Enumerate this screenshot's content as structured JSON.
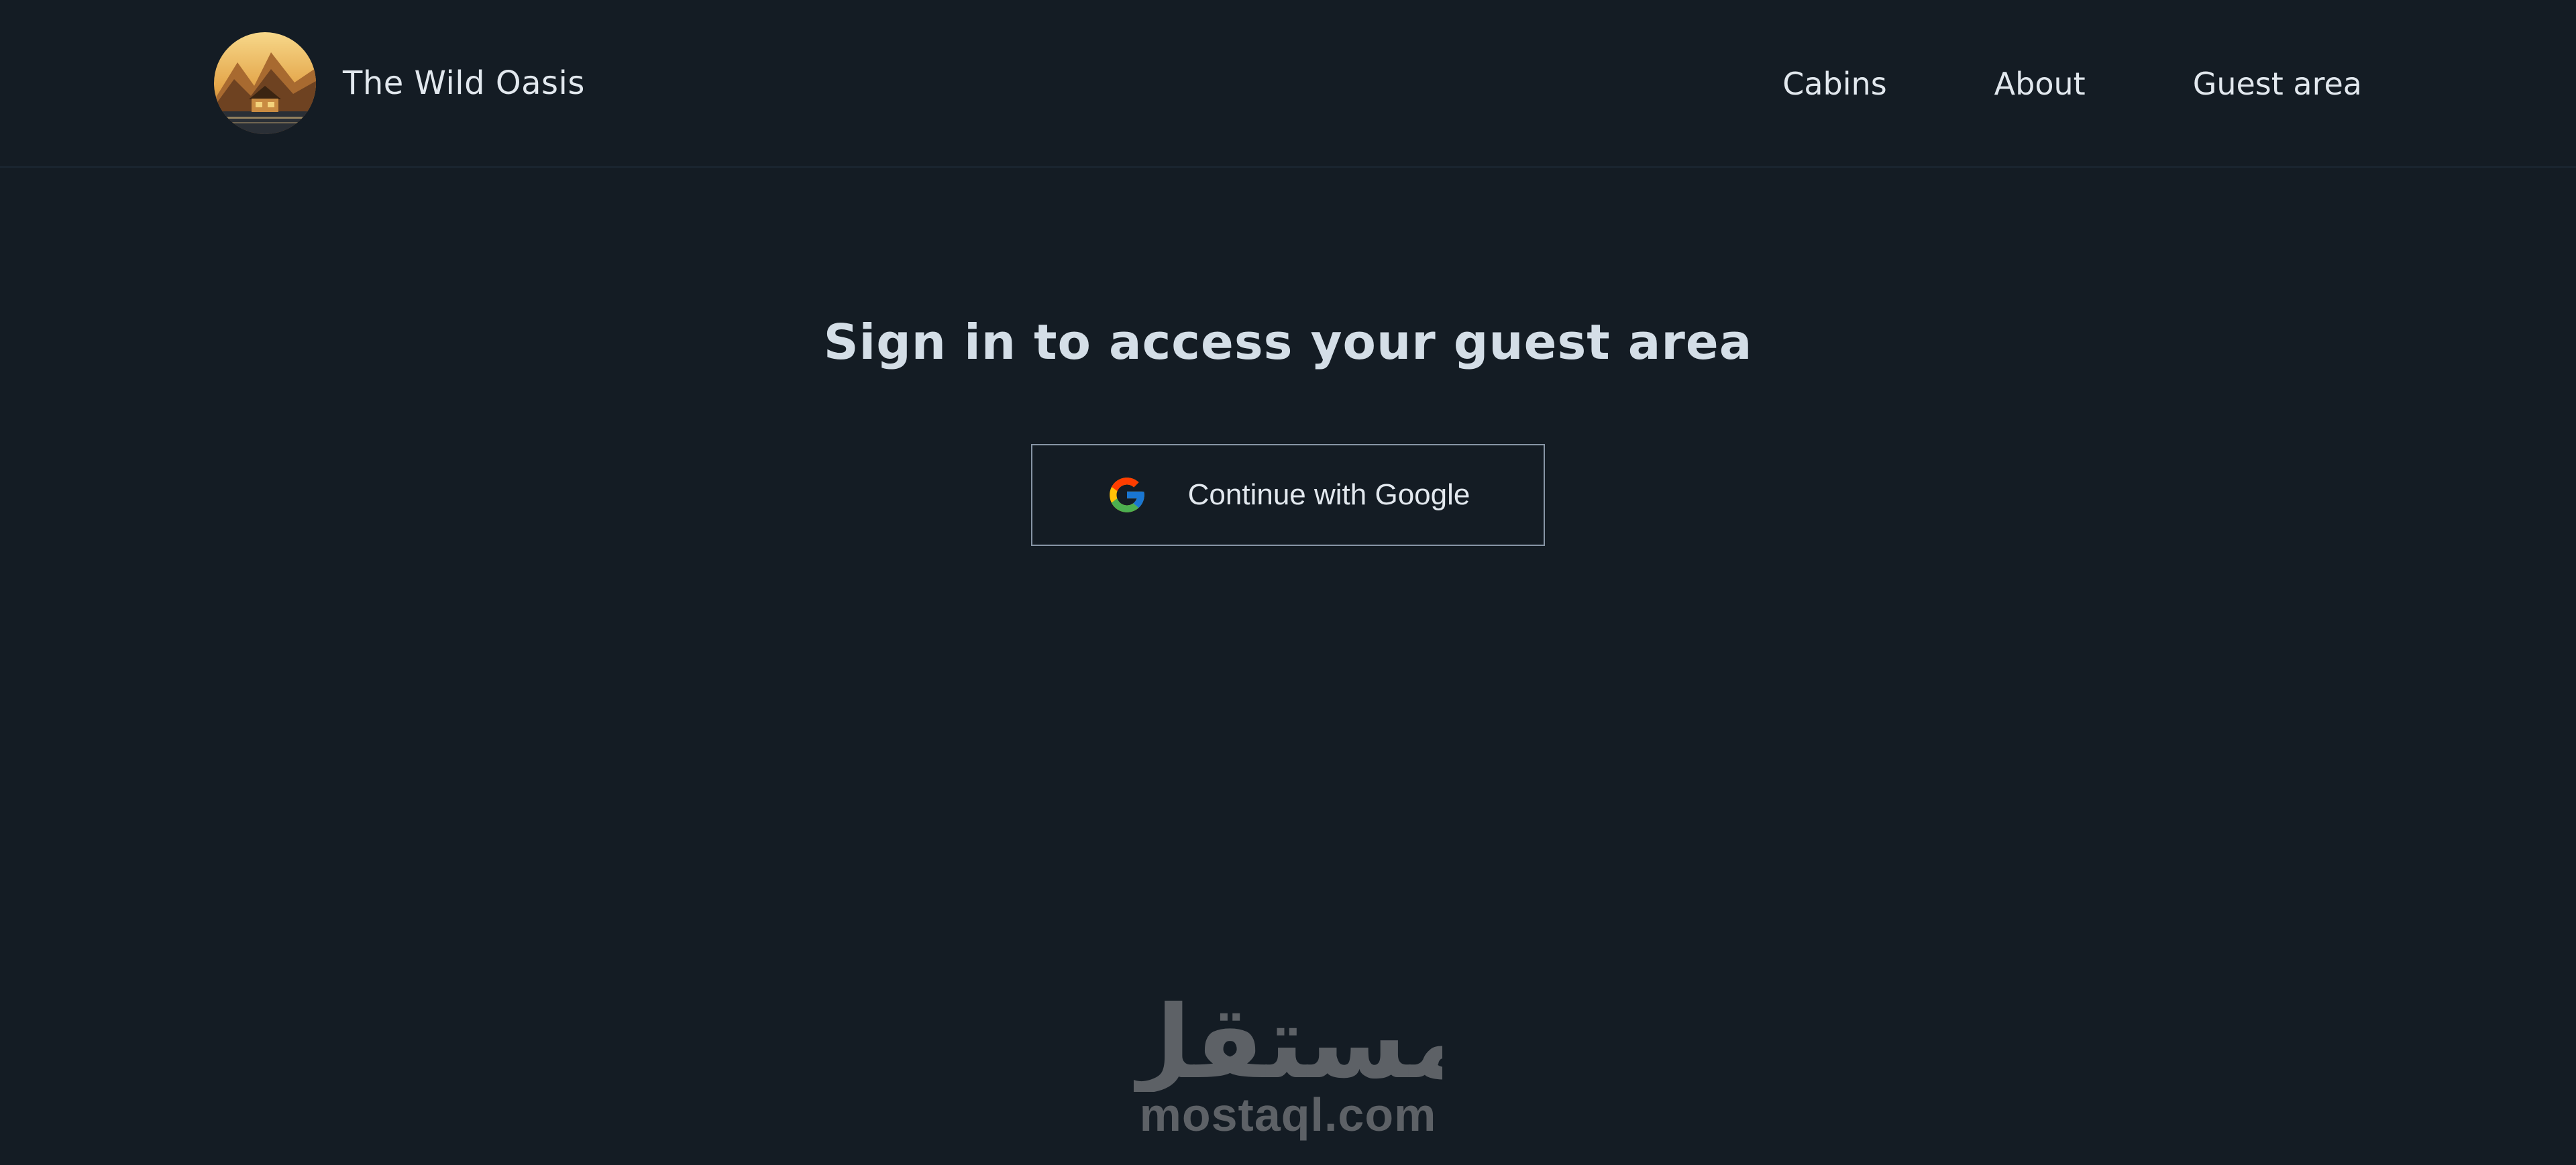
{
  "header": {
    "brand": "The Wild Oasis",
    "nav": [
      {
        "label": "Cabins"
      },
      {
        "label": "About"
      },
      {
        "label": "Guest area"
      }
    ]
  },
  "main": {
    "title": "Sign in to access your guest area",
    "google_button_label": "Continue with Google"
  },
  "watermark": {
    "arabic_logo": "مستقل",
    "text": "mostaql.com"
  },
  "colors": {
    "background": "#141c24",
    "text": "#d4dee7",
    "button_border": "#8795a5",
    "watermark": "#5d6166"
  },
  "icons": {
    "logo": "mountain-cabin-logo",
    "google": "google-g-icon"
  }
}
